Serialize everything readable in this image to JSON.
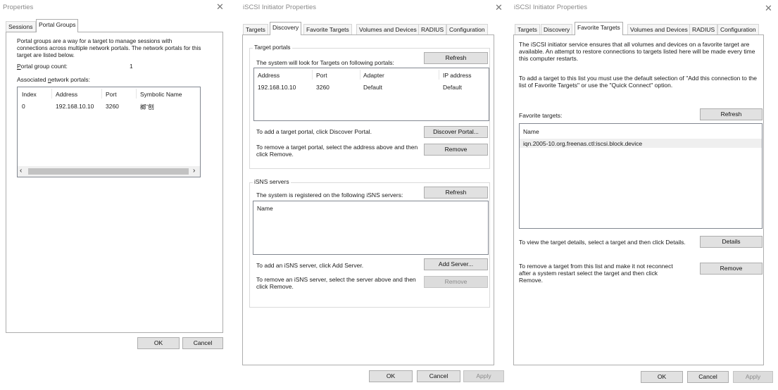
{
  "w1": {
    "title": "Properties",
    "tabs": [
      "Sessions",
      "Portal Groups"
    ],
    "desc": "Portal groups are a way for a target to manage sessions with connections across multiple network portals.  The network portals for this target are listed below.",
    "count_label_u": "P",
    "count_label_rest": "ortal group count:",
    "count_value": "1",
    "assoc_pre": "Associated ",
    "assoc_u": "n",
    "assoc_post": "etwork portals:",
    "columns": [
      "Index",
      "Address",
      "Port",
      "Symbolic Name"
    ],
    "row": [
      "0",
      "192.168.10.10",
      "3260",
      "榔ˇ刨"
    ],
    "ok": "OK",
    "cancel": "Cancel"
  },
  "w2": {
    "title": "iSCSI Initiator Properties",
    "tabs": [
      "Targets",
      "Discovery",
      "Favorite Targets",
      "Volumes and Devices",
      "RADIUS",
      "Configuration"
    ],
    "portals_group": "Target portals",
    "portals_text": "The system will look for Targets on following portals:",
    "refresh": "Refresh",
    "columns": [
      "Address",
      "Port",
      "Adapter",
      "IP address"
    ],
    "row": [
      "192.168.10.10",
      "3260",
      "Default",
      "Default"
    ],
    "add_portal_text": "To add a target portal, click Discover Portal.",
    "discover_button": "Discover Portal...",
    "remove_portal_text": "To remove a target portal, select the address above and then click Remove.",
    "remove": "Remove",
    "isns_group": "iSNS servers",
    "isns_text": "The system is registered on the following iSNS servers:",
    "isns_refresh": "Refresh",
    "isns_column": "Name",
    "add_server_text": "To add an iSNS server, click Add Server.",
    "add_server_button": "Add Server...",
    "remove_server_text": "To remove an iSNS server, select the server above and then click Remove.",
    "remove_server_button": "Remove",
    "ok": "OK",
    "cancel": "Cancel",
    "apply": "Apply"
  },
  "w3": {
    "title": "iSCSI Initiator Properties",
    "tabs": [
      "Targets",
      "Discovery",
      "Favorite Targets",
      "Volumes and Devices",
      "RADIUS",
      "Configuration"
    ],
    "desc1": "The iSCSI initiator service ensures that all volumes and devices on a favorite target are available.  An attempt to restore connections to targets listed here will be made every time this computer restarts.",
    "desc2": "To add a target to this list you must use the default selection of \"Add this connection to the list of Favorite Targets\" or use the \"Quick Connect\" option.",
    "fav_label": "Favorite targets:",
    "refresh": "Refresh",
    "column": "Name",
    "item": "iqn.2005-10.org.freenas.ctl:iscsi.block.device",
    "details_text": "To view the target details, select a target and then click Details.",
    "details": "Details",
    "remove_text": "To remove a target from this list and make it not reconnect after a system restart select the target and then click Remove.",
    "remove": "Remove",
    "ok": "OK",
    "cancel": "Cancel",
    "apply": "Apply"
  }
}
